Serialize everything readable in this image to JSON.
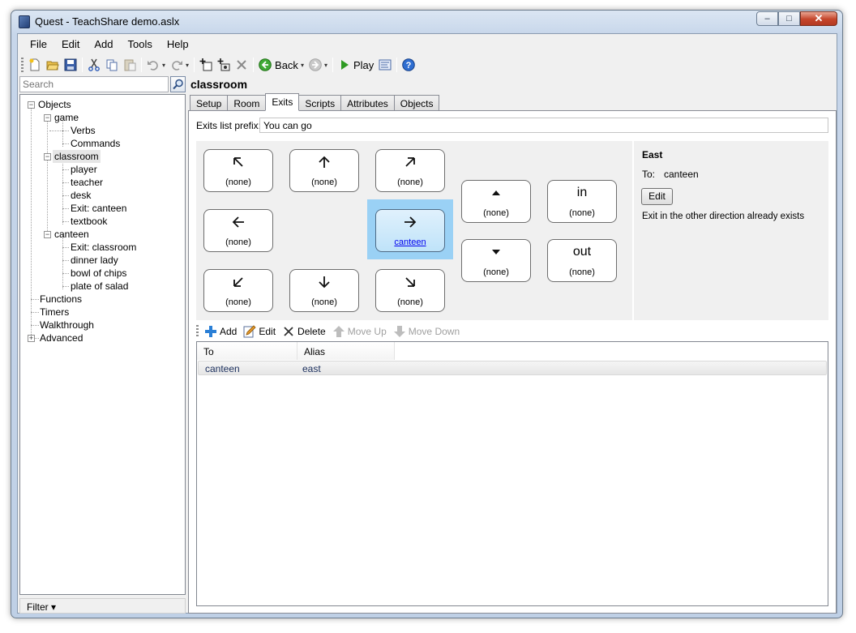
{
  "window": {
    "title": "Quest - TeachShare demo.aslx",
    "min": "–",
    "max": "□",
    "close": "✕"
  },
  "menu": [
    "File",
    "Edit",
    "Add",
    "Tools",
    "Help"
  ],
  "toolbar": {
    "back": "Back",
    "play": "Play"
  },
  "search": {
    "placeholder": "Search"
  },
  "tree": {
    "objects": "Objects",
    "game": "game",
    "verbs": "Verbs",
    "commands": "Commands",
    "classroom": "classroom",
    "player": "player",
    "teacher": "teacher",
    "desk": "desk",
    "exit_canteen": "Exit: canteen",
    "textbook": "textbook",
    "canteen": "canteen",
    "exit_classroom": "Exit: classroom",
    "dinner_lady": "dinner lady",
    "bowl_of_chips": "bowl of chips",
    "plate_of_salad": "plate of salad",
    "functions": "Functions",
    "timers": "Timers",
    "walkthrough": "Walkthrough",
    "advanced": "Advanced"
  },
  "filter": "Filter ▾",
  "editor": {
    "heading": "classroom",
    "tabs": [
      "Setup",
      "Room",
      "Exits",
      "Scripts",
      "Attributes",
      "Objects"
    ],
    "active_tab": "Exits",
    "prefix_label": "Exits list prefix:",
    "prefix_value": "You can go"
  },
  "directions": {
    "northwest": "(none)",
    "north": "(none)",
    "northeast": "(none)",
    "west": "(none)",
    "east": "canteen",
    "southwest": "(none)",
    "south": "(none)",
    "southeast": "(none)",
    "up": "(none)",
    "down": "(none)",
    "in_word": "in",
    "in": "(none)",
    "out_word": "out",
    "out": "(none)"
  },
  "detail": {
    "title": "East",
    "to_label": "To:",
    "to_value": "canteen",
    "edit": "Edit",
    "message": "Exit in the other direction already exists"
  },
  "exits_toolbar": {
    "add": "Add",
    "edit": "Edit",
    "delete": "Delete",
    "move_up": "Move Up",
    "move_down": "Move Down"
  },
  "exits_list": {
    "columns": [
      "To",
      "Alias"
    ],
    "rows": [
      {
        "to": "canteen",
        "alias": "east"
      }
    ]
  }
}
